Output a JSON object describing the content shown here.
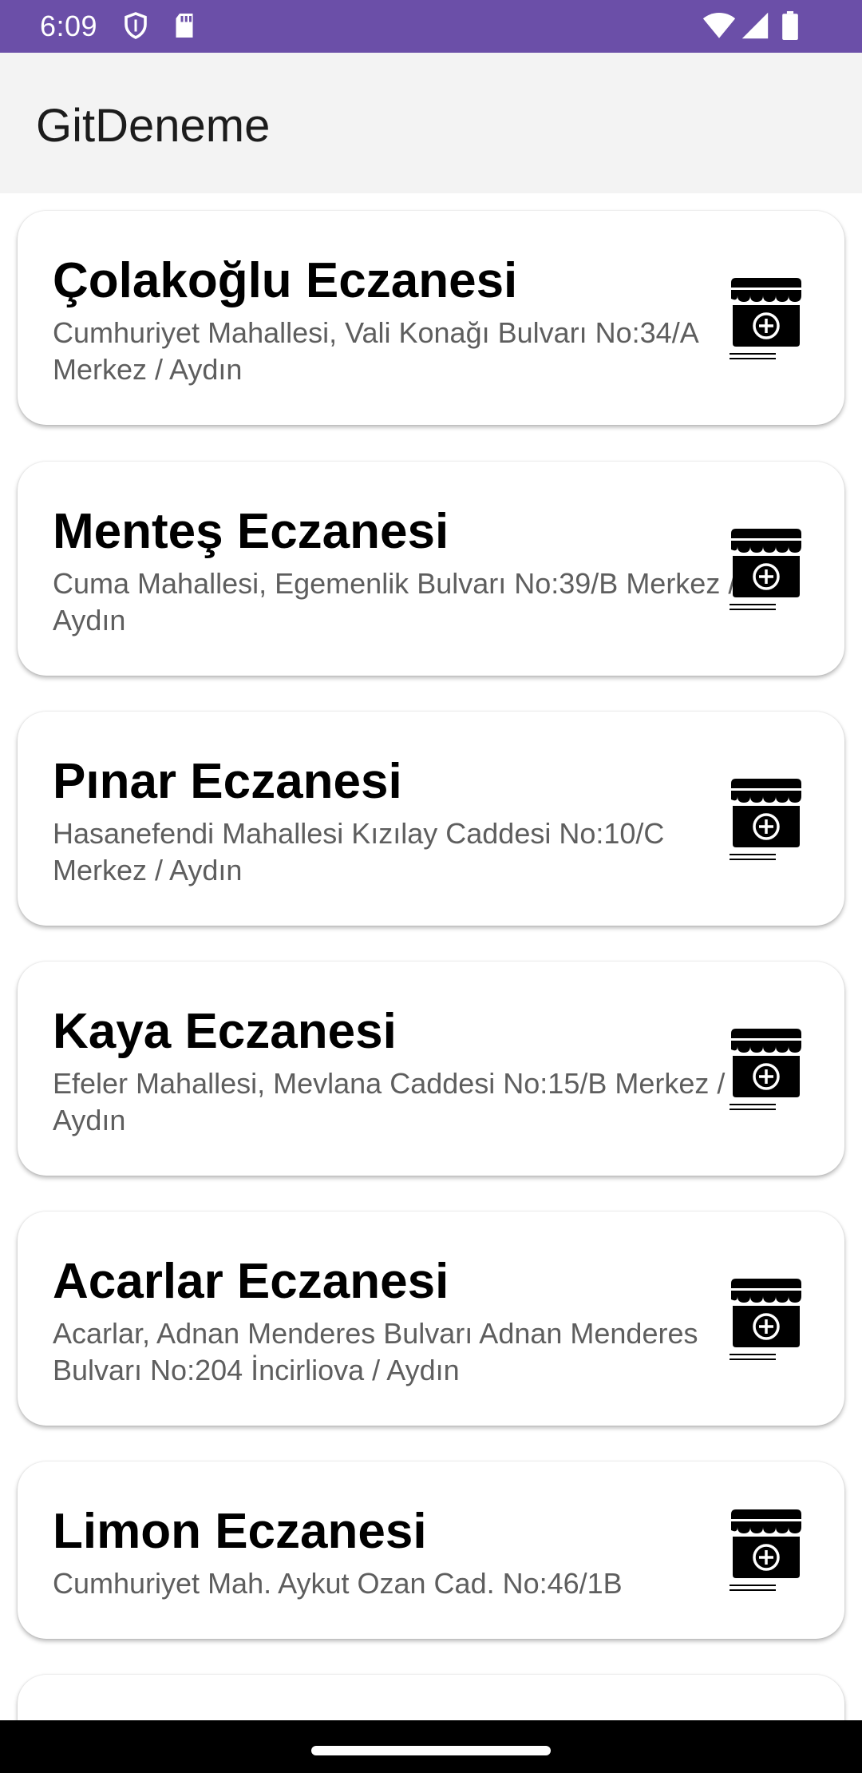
{
  "status_bar": {
    "time": "6:09",
    "left_icons": [
      "shield-icon",
      "sd-card-icon"
    ],
    "right_icons": [
      "wifi-icon",
      "signal-icon",
      "battery-icon"
    ],
    "color": "#6b4fa8"
  },
  "app_bar": {
    "title": "GitDeneme"
  },
  "pharmacies": [
    {
      "name": "Çolakoğlu Eczanesi",
      "address": "Cumhuriyet Mahallesi, Vali Konağı Bulvarı No:34/A Merkez / Aydın",
      "icon": "store-plus-icon"
    },
    {
      "name": "Menteş Eczanesi",
      "address": "Cuma Mahallesi, Egemenlik Bulvarı No:39/B Merkez / Aydın",
      "icon": "store-plus-icon"
    },
    {
      "name": "Pınar Eczanesi",
      "address": "Hasanefendi Mahallesi Kızılay Caddesi No:10/C Merkez / Aydın",
      "icon": "store-plus-icon"
    },
    {
      "name": "Kaya Eczanesi",
      "address": "Efeler Mahallesi, Mevlana Caddesi No:15/B Merkez / Aydın",
      "icon": "store-plus-icon"
    },
    {
      "name": "Acarlar Eczanesi",
      "address": "Acarlar, Adnan Menderes Bulvarı Adnan Menderes Bulvarı No:204 İncirliova / Aydın",
      "icon": "store-plus-icon"
    },
    {
      "name": "Limon Eczanesi",
      "address": "Cumhuriyet Mah. Aykut Ozan Cad. No:46/1B",
      "icon": "store-plus-icon"
    }
  ]
}
